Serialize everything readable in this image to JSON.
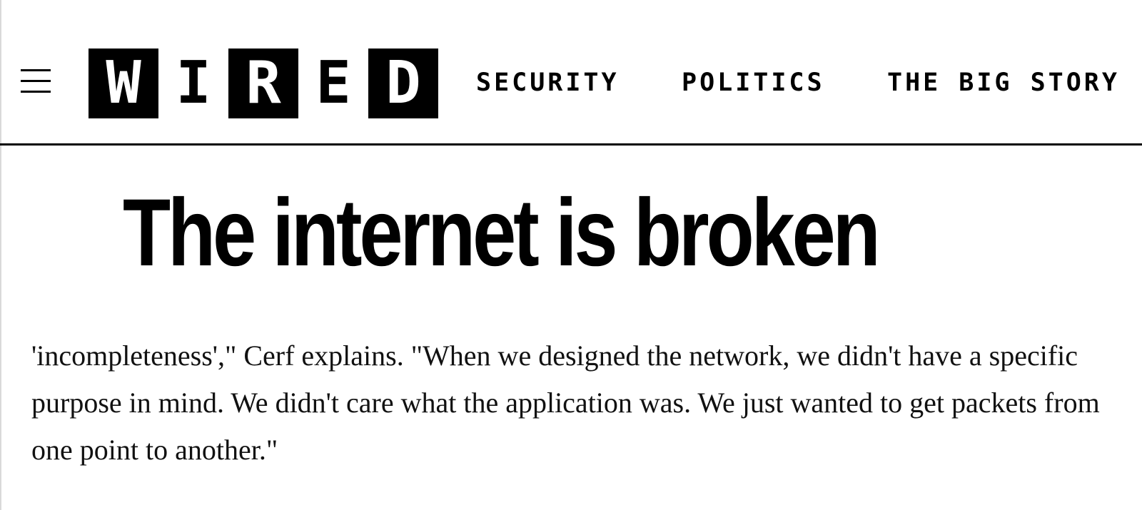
{
  "header": {
    "menu_icon": "hamburger-menu-icon",
    "logo": {
      "letters": [
        "W",
        "I",
        "R",
        "E",
        "D"
      ],
      "label": "WIRED"
    },
    "nav": [
      "SECURITY",
      "POLITICS",
      "THE BIG STORY"
    ]
  },
  "article": {
    "headline": "The internet is broken",
    "paragraph": "'incompleteness',\" Cerf explains. \"When we designed the network, we didn't have a specific purpose in mind. We didn't care what the application was. We just wanted to get packets from one point to another.\""
  },
  "colors": {
    "text": "#000000",
    "background": "#ffffff",
    "divider": "#000000"
  }
}
